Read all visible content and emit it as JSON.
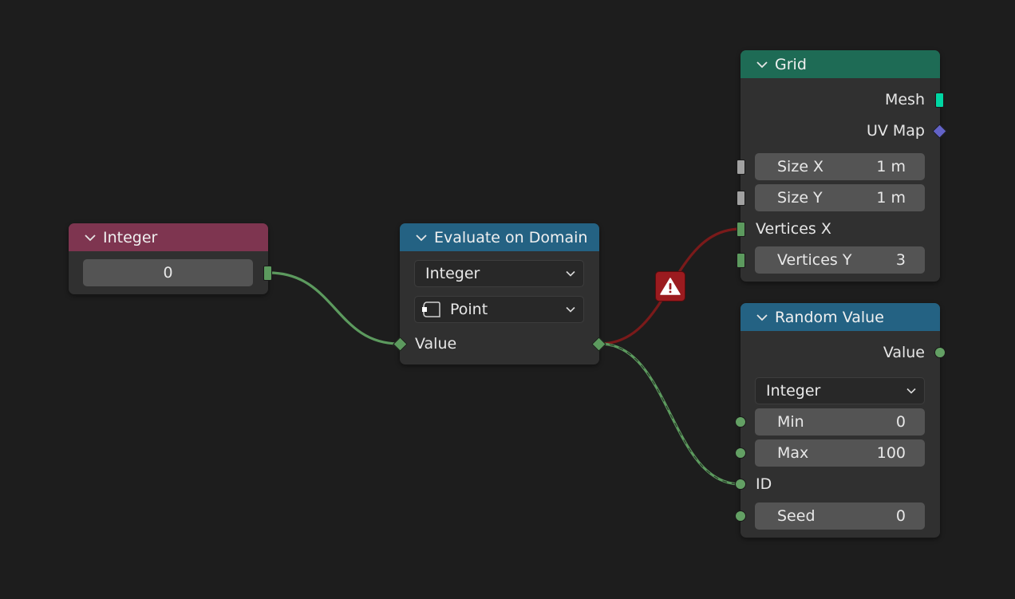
{
  "nodes": {
    "integer": {
      "title": "Integer",
      "value": "0",
      "header_color": "#7e3550"
    },
    "evaluate": {
      "title": "Evaluate on Domain",
      "data_type": "Integer",
      "domain": "Point",
      "value_label": "Value",
      "header_color": "#246283"
    },
    "grid": {
      "title": "Grid",
      "mesh_label": "Mesh",
      "uvmap_label": "UV Map",
      "size_x_label": "Size X",
      "size_x_value": "1 m",
      "size_y_label": "Size Y",
      "size_y_value": "1 m",
      "vertices_x_label": "Vertices X",
      "vertices_y_label": "Vertices Y",
      "vertices_y_value": "3",
      "header_color": "#1e6b55"
    },
    "random": {
      "title": "Random Value",
      "value_label": "Value",
      "data_type": "Integer",
      "min_label": "Min",
      "min_value": "0",
      "max_label": "Max",
      "max_value": "100",
      "id_label": "ID",
      "seed_label": "Seed",
      "seed_value": "0",
      "header_color": "#246283"
    }
  },
  "colors": {
    "integer_socket": "#5c9a5e",
    "float_socket": "#a1a1a1",
    "geometry_socket": "#00d6a3",
    "vector_socket": "#6363c7",
    "invalid_link": "#7a1a1a",
    "link": "#5c9a5e"
  },
  "icons": {
    "warning": "warning-triangle-icon",
    "domain": "point-domain-icon"
  }
}
